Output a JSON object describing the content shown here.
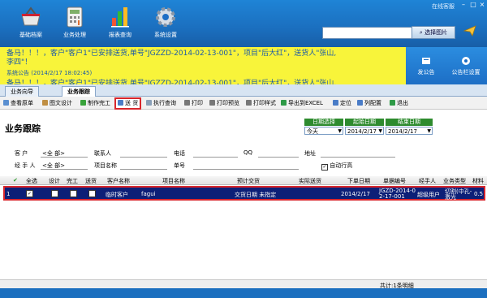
{
  "window": {
    "online_status": "在线客服"
  },
  "nav": [
    {
      "label": "基础档案"
    },
    {
      "label": "业务处理"
    },
    {
      "label": "报表查询"
    },
    {
      "label": "系统设置"
    }
  ],
  "search": {
    "value": "",
    "button_label": "选择图片"
  },
  "notice": {
    "line1": "备马！！！，客户\"客户1\"已安排送货,单号\"JGZZD-2014-02-13-001\"，项目\"后大红\"，送货人\"张山,",
    "line2": "李四\"！",
    "line3": "系统公告 (2014/2/17 18:02:45)",
    "line4": "备马！！！，客户\"客户1\"已安排送货,单号\"JGZZD-2014-02-13-001\"，项目\"后大红\"，送货人\"张山,"
  },
  "right_panel": {
    "item1": "发公告",
    "item2": "公告栏设置"
  },
  "tabs": [
    {
      "label": "业务向导"
    },
    {
      "label": "业务跟踪"
    }
  ],
  "toolbar": {
    "view_order": "查看原单",
    "design": "图文设计",
    "finish": "制作完工",
    "send": "送 货",
    "execute_query": "执行查询",
    "print": "打印",
    "print_preview": "打印预览",
    "print_style": "打印样式",
    "export_excel": "导出到EXCEL",
    "locate": "定位",
    "column_config": "列配置",
    "exit": "退出"
  },
  "page": {
    "title": "业务跟踪"
  },
  "date_filter": {
    "header_date_select": "日期选择",
    "header_start": "起始日期",
    "header_end": "结束日期",
    "period": "今天",
    "start_date": "2014/2/17",
    "end_date": "2014/2/17"
  },
  "filters": {
    "customer_label": "客    户",
    "customer_value": "<全 部>",
    "contact_label": "联系人",
    "phone_label": "电话",
    "qq_label": "QQ",
    "address_label": "地址",
    "handler_label": "经 手 人",
    "handler_value": "<全 部>",
    "project_label": "项目名称",
    "order_label": "单号",
    "auto_wrap_label": "自动行高"
  },
  "grid": {
    "headers": [
      "全选",
      "设计",
      "完工",
      "送货",
      "客户名称",
      "项目名称",
      "预计交货",
      "实际送货",
      "下单日期",
      "单据编号",
      "经手人",
      "业务类型",
      "材料"
    ],
    "row": {
      "index": "1",
      "customer": "临时客户",
      "project": "fagui",
      "expected_delivery": "交货日期 未指定",
      "order_date": "2014/2/17",
      "order_no_1": "JGZD-2014-0",
      "order_no_2": "2-17-001",
      "handler": "超级用户",
      "biz_type_1": "切割(中孔-",
      "biz_type_2": "激光",
      "material": "0.5"
    }
  },
  "footer": {
    "total": "共计:1条明细"
  }
}
